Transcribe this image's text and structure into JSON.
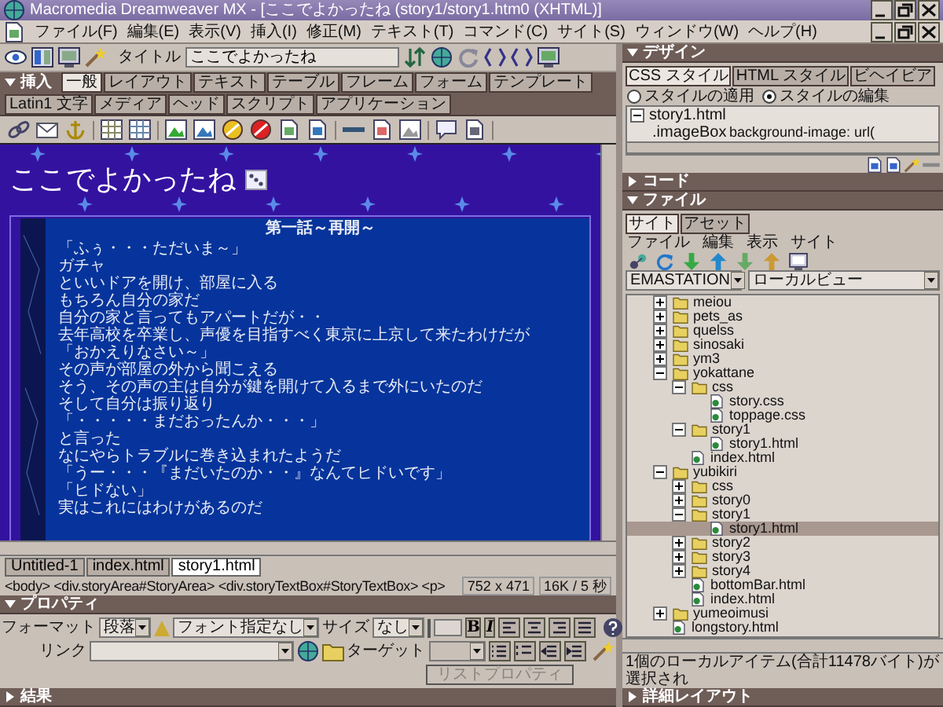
{
  "window": {
    "title": "Macromedia Dreamweaver MX - [ここでよかったね (story1/story1.htm0 (XHTML)]"
  },
  "menu": [
    "ファイル(F)",
    "編集(E)",
    "表示(V)",
    "挿入(I)",
    "修正(M)",
    "テキスト(T)",
    "コマンド(C)",
    "サイト(S)",
    "ウィンドウ(W)",
    "ヘルプ(H)"
  ],
  "toolbar": {
    "title_label": "タイトル",
    "title_value": "ここでよかったね"
  },
  "insert_panel": {
    "title": "挿入",
    "expanded": true,
    "tabs": [
      {
        "label": "一般",
        "selected": true
      },
      {
        "label": "レイアウト",
        "selected": false
      },
      {
        "label": "テキスト",
        "selected": false
      },
      {
        "label": "テーブル",
        "selected": false
      },
      {
        "label": "フレーム",
        "selected": false
      },
      {
        "label": "フォーム",
        "selected": false
      },
      {
        "label": "テンプレート",
        "selected": false
      },
      {
        "label": "Latin1 文字",
        "selected": false
      },
      {
        "label": "メディア",
        "selected": false
      },
      {
        "label": "ヘッド",
        "selected": false
      },
      {
        "label": "スクリプト",
        "selected": false
      },
      {
        "label": "アプリケーション",
        "selected": false
      }
    ]
  },
  "document": {
    "heading": "ここでよかったね",
    "story_title": "第一話～再開～",
    "lines": [
      "「ふぅ・・・ただいま～」",
      "ガチャ",
      "といいドアを開け、部屋に入る",
      "もちろん自分の家だ",
      "自分の家と言ってもアパートだが・・",
      "去年高校を卒業し、声優を目指すべく東京に上京して来たわけだが",
      "「おかえりなさい～」",
      "その声が部屋の外から聞こえる",
      "そう、その声の主は自分が鍵を開けて入るまで外にいたのだ",
      "そして自分は振り返り",
      "「・・・・・まだおったんか・・・」",
      "と言った",
      "なにやらトラブルに巻き込まれたようだ",
      "「うー・・・『まだいたのか・・』なんてヒドいです」",
      "「ヒドない」",
      "実はこれにはわけがあるのだ"
    ]
  },
  "document_tabs": [
    {
      "label": "Untitled-1",
      "selected": false
    },
    {
      "label": "index.html",
      "selected": false
    },
    {
      "label": "story1.html",
      "selected": true
    }
  ],
  "status": {
    "tag_path": "<body> <div.storyArea#StoryArea> <div.storyTextBox#StoryTextBox> <p>",
    "size": "752 x 471",
    "download": "16K / 5 秒"
  },
  "properties": {
    "title": "プロパティ",
    "expanded": true,
    "format_label": "フォーマット",
    "format_value": "段落",
    "font_value": "フォント指定なし",
    "size_label": "サイズ",
    "size_value": "なし",
    "bold_label": "B",
    "italic_label": "I",
    "link_label": "リンク",
    "target_label": "ターゲット",
    "list_button": {
      "label": "リストプロパティ",
      "disabled": true
    }
  },
  "results_panel": {
    "title": "結果",
    "expanded": false
  },
  "design_panel": {
    "title": "デザイン",
    "expanded": true,
    "tabs": [
      {
        "label": "CSS スタイル",
        "selected": true
      },
      {
        "label": "HTML スタイル",
        "selected": false
      },
      {
        "label": "ビヘイビア",
        "selected": false
      }
    ],
    "radios": [
      {
        "label": "スタイルの適用",
        "selected": false
      },
      {
        "label": "スタイルの編集",
        "selected": true
      }
    ],
    "styles": [
      {
        "name": "story1.html",
        "expanded": true,
        "rules": [
          {
            "selector": ".imageBox",
            "value": "background-image: url("
          }
        ]
      }
    ]
  },
  "code_panel": {
    "title": "コード",
    "expanded": false
  },
  "files_panel": {
    "title": "ファイル",
    "expanded": true,
    "tabs": [
      {
        "label": "サイト",
        "selected": true
      },
      {
        "label": "アセット",
        "selected": false
      }
    ],
    "menu": [
      "ファイル",
      "編集",
      "表示",
      "サイト"
    ],
    "site": "EMASTATION",
    "view": "ローカルビュー",
    "tree": [
      {
        "name": "meiou",
        "kind": "folder",
        "expanded": false,
        "selected": false
      },
      {
        "name": "pets_as",
        "kind": "folder",
        "expanded": false,
        "selected": false
      },
      {
        "name": "quelss",
        "kind": "folder",
        "expanded": false,
        "selected": false
      },
      {
        "name": "sinosaki",
        "kind": "folder",
        "expanded": false,
        "selected": false
      },
      {
        "name": "ym3",
        "kind": "folder",
        "expanded": false,
        "selected": false
      },
      {
        "name": "yokattane",
        "kind": "folder",
        "expanded": true,
        "selected": false,
        "children": [
          {
            "name": "css",
            "kind": "folder",
            "expanded": true,
            "selected": false,
            "children": [
              {
                "name": "story.css",
                "kind": "file",
                "selected": false
              },
              {
                "name": "toppage.css",
                "kind": "file",
                "selected": false
              }
            ]
          },
          {
            "name": "story1",
            "kind": "folder",
            "expanded": true,
            "selected": false,
            "children": [
              {
                "name": "story1.html",
                "kind": "file",
                "selected": false
              }
            ]
          },
          {
            "name": "index.html",
            "kind": "file",
            "selected": false
          }
        ]
      },
      {
        "name": "yubikiri",
        "kind": "folder",
        "expanded": true,
        "selected": false,
        "children": [
          {
            "name": "css",
            "kind": "folder",
            "expanded": false,
            "selected": false
          },
          {
            "name": "story0",
            "kind": "folder",
            "expanded": false,
            "selected": false
          },
          {
            "name": "story1",
            "kind": "folder",
            "expanded": true,
            "selected": false,
            "children": [
              {
                "name": "story1.html",
                "kind": "file",
                "selected": true
              }
            ]
          },
          {
            "name": "story2",
            "kind": "folder",
            "expanded": false,
            "selected": false
          },
          {
            "name": "story3",
            "kind": "folder",
            "expanded": false,
            "selected": false
          },
          {
            "name": "story4",
            "kind": "folder",
            "expanded": false,
            "selected": false
          },
          {
            "name": "bottomBar.html",
            "kind": "file",
            "selected": false
          },
          {
            "name": "index.html",
            "kind": "file",
            "selected": false
          }
        ]
      },
      {
        "name": "yumeoimusi",
        "kind": "folder",
        "expanded": false,
        "selected": false
      },
      {
        "name": "longstory.html",
        "kind": "file",
        "selected": false
      }
    ],
    "status": "1個のローカルアイテム(合計11478バイト)が選択され"
  },
  "details_panel": {
    "title": "詳細レイアウト",
    "expanded": false
  }
}
